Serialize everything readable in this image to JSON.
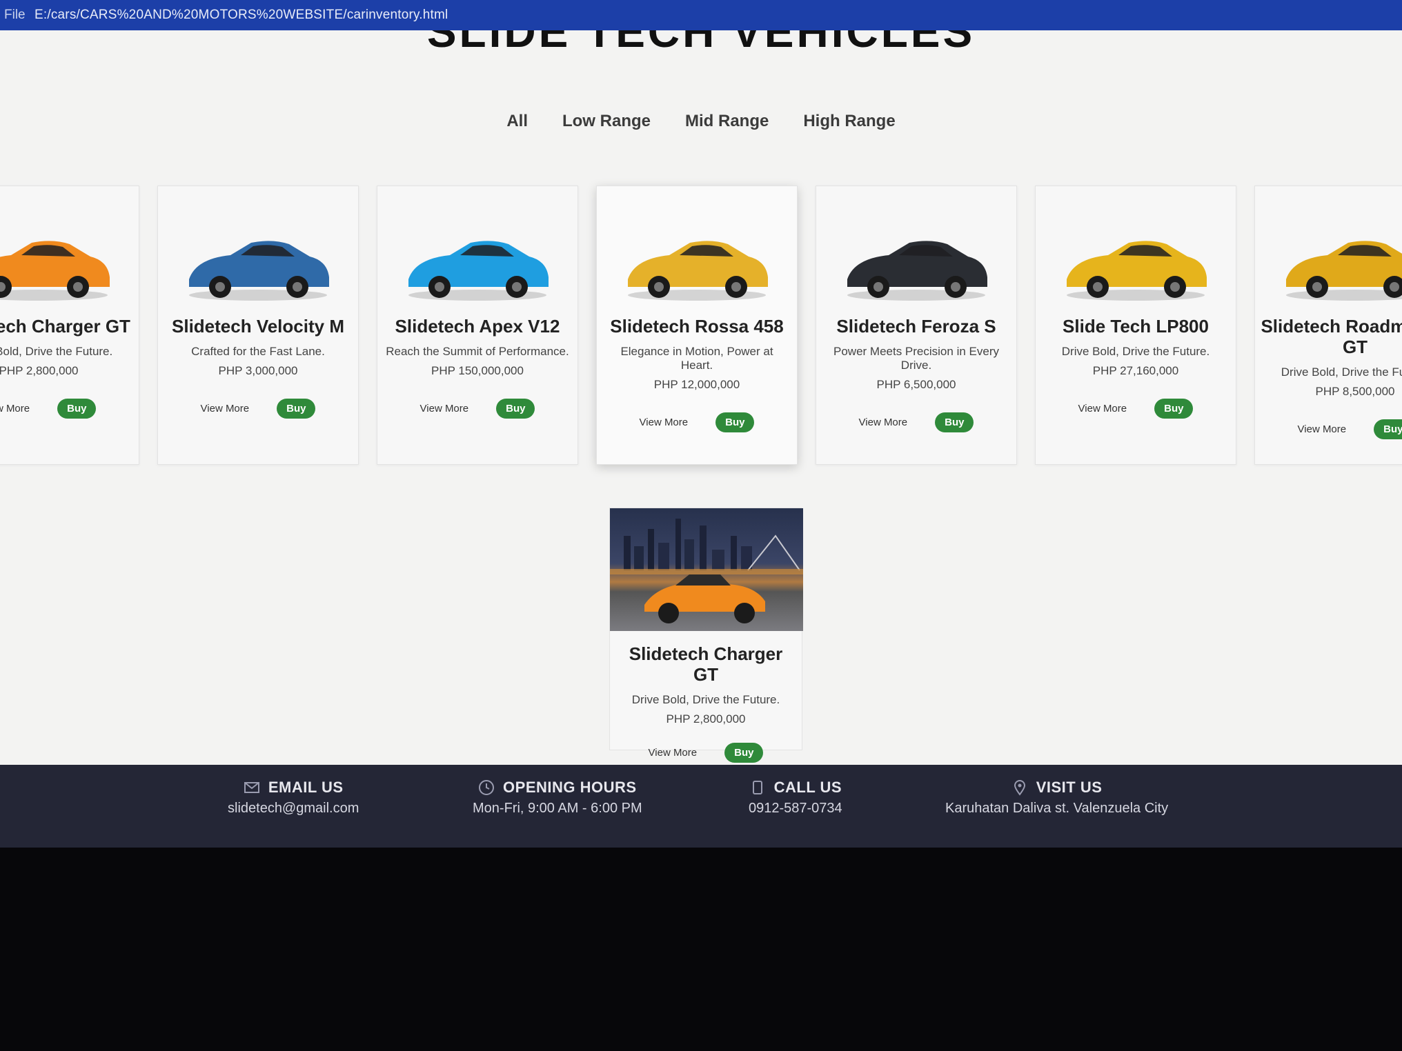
{
  "browser": {
    "file_label": "File",
    "url": "E:/cars/CARS%20AND%20MOTORS%20WEBSITE/carinventory.html"
  },
  "page": {
    "heading": "SLIDE TECH VEHICLES",
    "filters": [
      "All",
      "Low Range",
      "Mid Range",
      "High Range"
    ]
  },
  "cards": [
    {
      "title": "Slidetech Charger GT",
      "tagline": "Drive Bold, Drive the Future.",
      "price": "PHP 2,800,000",
      "color": "#f08a1e"
    },
    {
      "title": "Slidetech Velocity M",
      "tagline": "Crafted for the Fast Lane.",
      "price": "PHP 3,000,000",
      "color": "#2f6aa8"
    },
    {
      "title": "Slidetech Apex V12",
      "tagline": "Reach the Summit of Performance.",
      "price": "PHP 150,000,000",
      "color": "#1f9ee0"
    },
    {
      "title": "Slidetech Rossa 458",
      "tagline": "Elegance in Motion, Power at Heart.",
      "price": "PHP 12,000,000",
      "color": "#e5b12a"
    },
    {
      "title": "Slidetech Feroza S",
      "tagline": "Power Meets Precision in Every Drive.",
      "price": "PHP 6,500,000",
      "color": "#2a2d33"
    },
    {
      "title": "Slide Tech LP800",
      "tagline": "Drive Bold, Drive the Future.",
      "price": "PHP 27,160,000",
      "color": "#e6b41c"
    },
    {
      "title": "Slidetech Roadmaster GT",
      "tagline": "Drive Bold, Drive the Future.",
      "price": "PHP 8,500,000",
      "color": "#e0a91a"
    }
  ],
  "featured": {
    "title": "Slidetech Charger GT",
    "tagline": "Drive Bold, Drive the Future.",
    "price": "PHP 2,800,000"
  },
  "buttons": {
    "view_more": "View More",
    "buy": "Buy"
  },
  "footer": {
    "email": {
      "label": "EMAIL US",
      "value": "slidetech@gmail.com"
    },
    "hours": {
      "label": "OPENING HOURS",
      "value": "Mon-Fri, 9:00 AM - 6:00 PM"
    },
    "call": {
      "label": "CALL US",
      "value": "0912-587-0734"
    },
    "visit": {
      "label": "VISIT US",
      "value": "Karuhatan Daliva st. Valenzuela City"
    }
  }
}
